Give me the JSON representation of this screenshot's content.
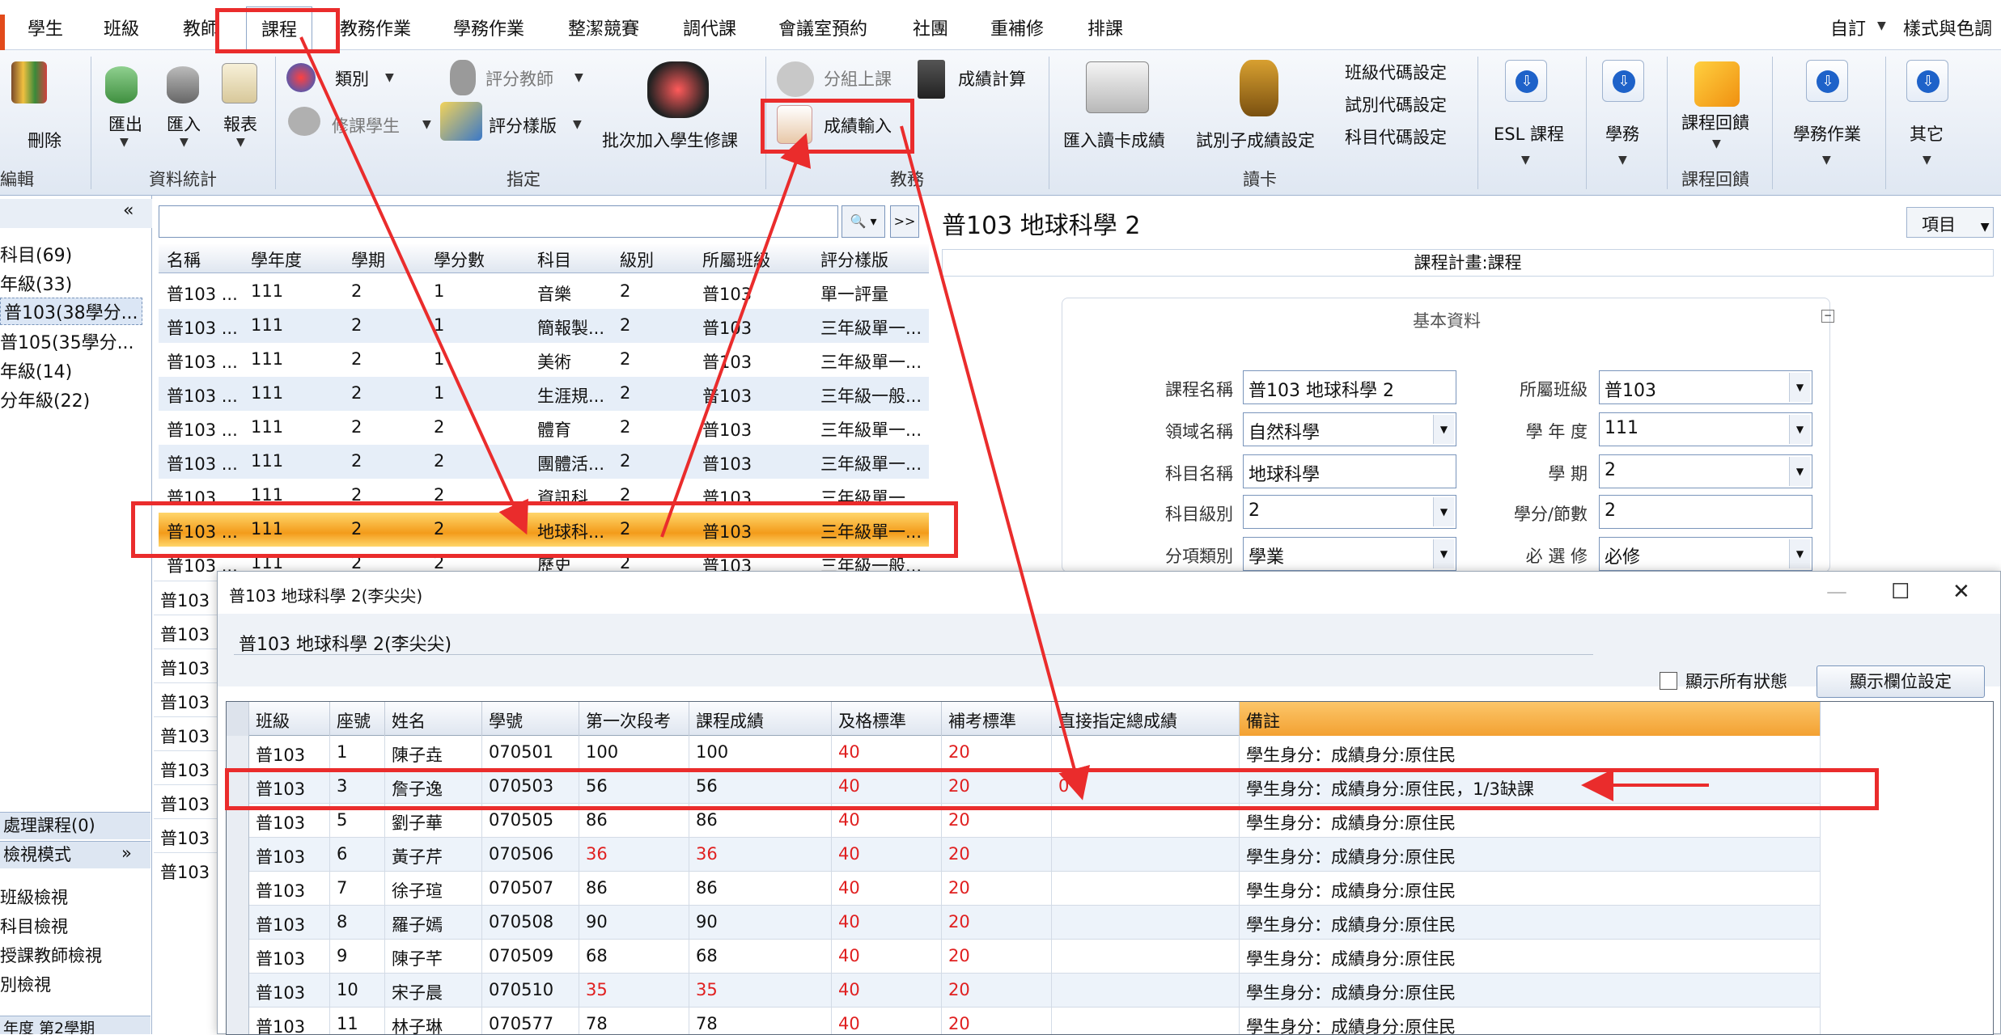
{
  "menu_tabs": [
    "學生",
    "班級",
    "教師",
    "課程",
    "教務作業",
    "學務作業",
    "整潔競賽",
    "調代課",
    "會議室預約",
    "社團",
    "重補修",
    "排課"
  ],
  "active_tab": "課程",
  "top_right": {
    "customize": "自訂",
    "style": "樣式與色調"
  },
  "ribbon": {
    "delete": "刪除",
    "export": "匯出",
    "import": "匯入",
    "report": "報表",
    "category": "類別",
    "grading_teacher": "評分教師",
    "enroll_student": "修課學生",
    "grade_template": "評分樣版",
    "batch_add": "批次加入學生修課",
    "group_class": "分組上課",
    "score_calc": "成績計算",
    "score_input": "成績輸入",
    "import_card": "匯入讀卡成績",
    "sub_score": "試別子成績設定",
    "class_code": "班級代碼設定",
    "exam_code": "試別代碼設定",
    "subject_code": "科目代碼設定",
    "esl": "ESL 課程",
    "student_affairs": "學務",
    "course_feedback": "課程回饋",
    "student_affairs_ops": "學務作業",
    "others": "其它",
    "groups": [
      "編輯",
      "資料統計",
      "指定",
      "教務",
      "讀卡",
      "課程回饋"
    ]
  },
  "left_tree": {
    "collapse": "«",
    "items": [
      "科目(69)",
      "年級(33)",
      "普103(38學分...",
      "普105(35學分...",
      "年級(14)",
      "分年級(22)"
    ],
    "pending": "處理課程(0)",
    "view_mode": "檢視模式",
    "view_mode_chevron": "»",
    "views": [
      "班級檢視",
      "科目檢視",
      "授課教師檢視",
      "別檢視"
    ],
    "semester": "年度 第2學期"
  },
  "course_grid": {
    "search_button": "🔍",
    "next_button": ">>",
    "columns": [
      "名稱",
      "學年度",
      "學期",
      "學分數",
      "科目",
      "級別",
      "所屬班級",
      "評分樣版"
    ],
    "rows": [
      [
        "普103 ...",
        "111",
        "2",
        "1",
        "音樂",
        "2",
        "普103",
        "單一評量"
      ],
      [
        "普103 ...",
        "111",
        "2",
        "1",
        "簡報製...",
        "2",
        "普103",
        "三年級單一..."
      ],
      [
        "普103 ...",
        "111",
        "2",
        "1",
        "美術",
        "2",
        "普103",
        "三年級單一..."
      ],
      [
        "普103 ...",
        "111",
        "2",
        "1",
        "生涯規...",
        "2",
        "普103",
        "三年級一般..."
      ],
      [
        "普103 ...",
        "111",
        "2",
        "2",
        "體育",
        "2",
        "普103",
        "三年級單一..."
      ],
      [
        "普103 ...",
        "111",
        "2",
        "2",
        "團體活...",
        "2",
        "普103",
        "三年級單一..."
      ],
      [
        "普103 ...",
        "111",
        "2",
        "2",
        "資訊科...",
        "2",
        "普103",
        "三年級單一..."
      ],
      [
        "普103 ...",
        "111",
        "2",
        "2",
        "地球科...",
        "2",
        "普103",
        "三年級單一..."
      ],
      [
        "普103 ...",
        "111",
        "2",
        "2",
        "歷史",
        "2",
        "普103",
        "三年級一般..."
      ]
    ],
    "extra_left": [
      "普103",
      "普103",
      "普103",
      "普103",
      "普103",
      "普103",
      "普103",
      "普103",
      "普103"
    ]
  },
  "detail": {
    "title": "普103 地球科學 2",
    "items_button": "項目",
    "plan_bar": "課程計畫:課程",
    "panel_title": "基本資料",
    "fields": {
      "course_name_label": "課程名稱",
      "course_name": "普103 地球科學 2",
      "class_label": "所屬班級",
      "class": "普103",
      "domain_label": "領域名稱",
      "domain": "自然科學",
      "year_label": "學 年 度",
      "year": "111",
      "subject_label": "科目名稱",
      "subject": "地球科學",
      "semester_label": "學    期",
      "semester": "2",
      "level_label": "科目級別",
      "level": "2",
      "credit_label": "學分/節數",
      "credit": "2",
      "category_label": "分項類別",
      "category": "學業",
      "required_label": "必 選 修",
      "required": "必修"
    }
  },
  "dialog": {
    "title": "普103 地球科學 2(李尖尖)",
    "subtitle": "普103 地球科學 2(李尖尖)",
    "show_all": "顯示所有狀態",
    "column_settings": "顯示欄位設定",
    "columns": [
      "班級",
      "座號",
      "姓名",
      "學號",
      "第一次段考",
      "課程成績",
      "及格標準",
      "補考標準",
      "直接指定總成績",
      "備註"
    ],
    "rows": [
      {
        "cls": "普103",
        "seat": "1",
        "name": "陳子垚",
        "id": "070501",
        "exam": "100",
        "score": "100",
        "pass": "40",
        "makeup": "20",
        "direct": "",
        "note": "學生身分：成績身分:原住民"
      },
      {
        "cls": "普103",
        "seat": "3",
        "name": "詹子逸",
        "id": "070503",
        "exam": "56",
        "score": "56",
        "pass": "40",
        "makeup": "20",
        "direct": "0",
        "note": "學生身分：成績身分:原住民，1/3缺課"
      },
      {
        "cls": "普103",
        "seat": "5",
        "name": "劉子華",
        "id": "070505",
        "exam": "86",
        "score": "86",
        "pass": "40",
        "makeup": "20",
        "direct": "",
        "note": "學生身分：成績身分:原住民"
      },
      {
        "cls": "普103",
        "seat": "6",
        "name": "黃子芹",
        "id": "070506",
        "exam": "36",
        "score": "36",
        "pass": "40",
        "makeup": "20",
        "direct": "",
        "note": "學生身分：成績身分:原住民"
      },
      {
        "cls": "普103",
        "seat": "7",
        "name": "徐子瑄",
        "id": "070507",
        "exam": "86",
        "score": "86",
        "pass": "40",
        "makeup": "20",
        "direct": "",
        "note": "學生身分：成績身分:原住民"
      },
      {
        "cls": "普103",
        "seat": "8",
        "name": "羅子嫣",
        "id": "070508",
        "exam": "90",
        "score": "90",
        "pass": "40",
        "makeup": "20",
        "direct": "",
        "note": "學生身分：成績身分:原住民"
      },
      {
        "cls": "普103",
        "seat": "9",
        "name": "陳子芊",
        "id": "070509",
        "exam": "68",
        "score": "68",
        "pass": "40",
        "makeup": "20",
        "direct": "",
        "note": "學生身分：成績身分:原住民"
      },
      {
        "cls": "普103",
        "seat": "10",
        "name": "宋子晨",
        "id": "070510",
        "exam": "35",
        "score": "35",
        "pass": "40",
        "makeup": "20",
        "direct": "",
        "note": "學生身分：成績身分:原住民"
      },
      {
        "cls": "普103",
        "seat": "11",
        "name": "林子琳",
        "id": "070577",
        "exam": "78",
        "score": "78",
        "pass": "40",
        "makeup": "20",
        "direct": "",
        "note": "學生身分：成績身分:原住民"
      }
    ]
  },
  "colors": {
    "annotation": "#ea2c2c",
    "selected_row": "#f39b1a",
    "ribbon_bg": "#dfe7f2",
    "note_header": "#f3a132"
  }
}
